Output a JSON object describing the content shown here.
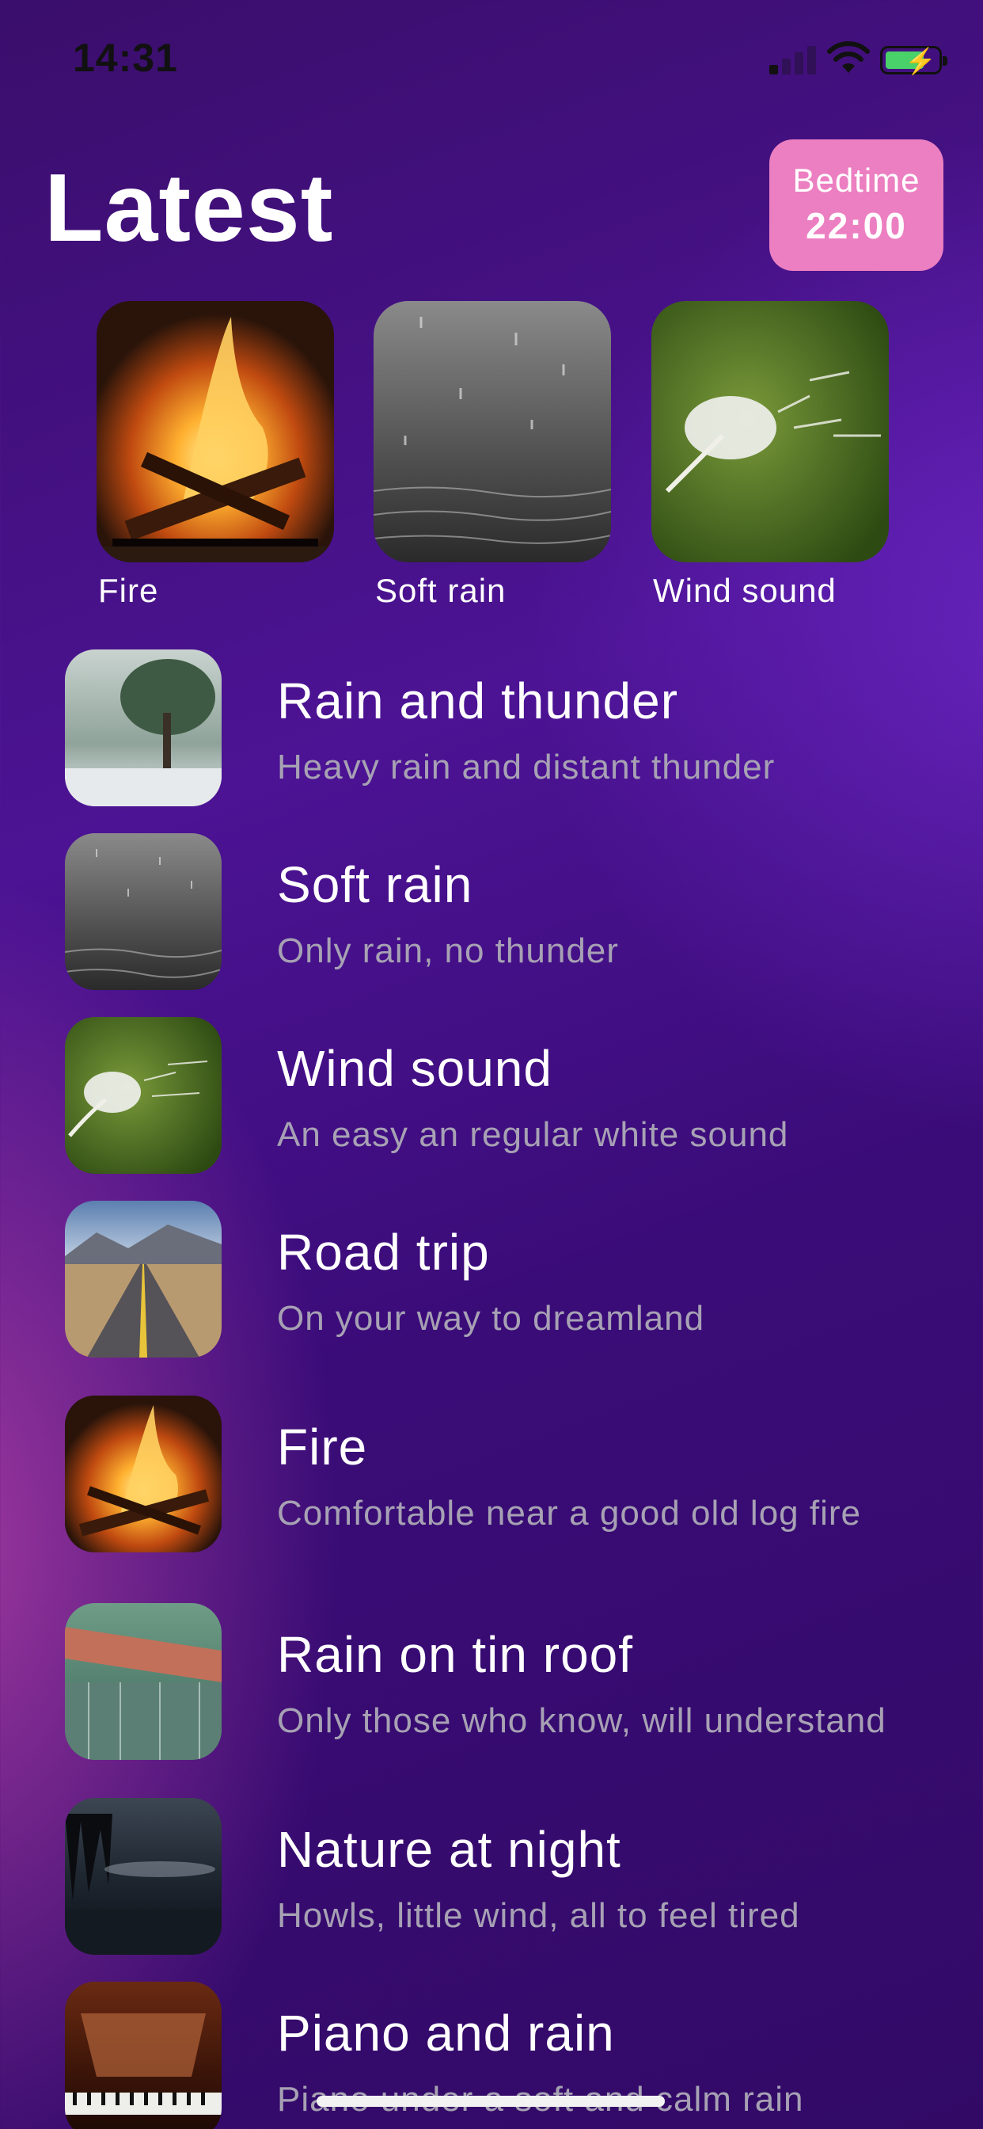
{
  "status_bar": {
    "time": "14:31"
  },
  "header": {
    "title": "Latest",
    "bedtime_label": "Bedtime",
    "bedtime_time": "22:00"
  },
  "featured": [
    {
      "caption": "Fire",
      "image": "fireplace"
    },
    {
      "caption": "Soft rain",
      "image": "rain-drops-water"
    },
    {
      "caption": "Wind sound",
      "image": "dandelion-wind"
    }
  ],
  "sounds": [
    {
      "title": "Rain and thunder",
      "subtitle": "Heavy rain and distant thunder",
      "image": "rain-tree"
    },
    {
      "title": "Soft rain",
      "subtitle": "Only rain, no thunder",
      "image": "rain-drops-water"
    },
    {
      "title": "Wind sound",
      "subtitle": "An easy an regular white sound",
      "image": "dandelion-wind"
    },
    {
      "title": "Road trip",
      "subtitle": "On your way to dreamland",
      "image": "desert-road"
    },
    {
      "title": "Fire",
      "subtitle": "Comfortable near a good old log fire",
      "image": "fireplace"
    },
    {
      "title": "Rain on tin roof",
      "subtitle": "Only those who know, will understand",
      "image": "tin-roof-rain"
    },
    {
      "title": "Nature at night",
      "subtitle": "Howls, little wind, all to feel tired",
      "image": "night-lake"
    },
    {
      "title": "Piano and rain",
      "subtitle": "Piano under a soft and calm rain",
      "image": "piano"
    }
  ],
  "colors": {
    "bedtime_badge": "#ec7fc1",
    "subtitle": "#a7a1b4",
    "battery": "#49d16a"
  }
}
